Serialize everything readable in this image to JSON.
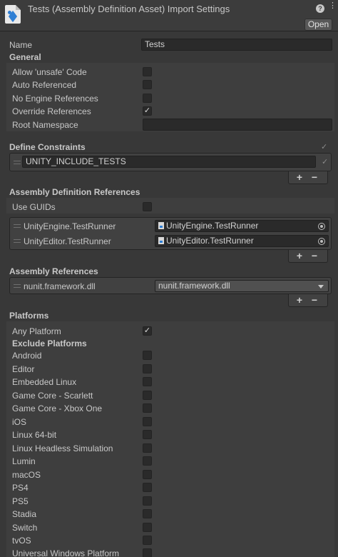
{
  "header": {
    "title": "Tests (Assembly Definition Asset) Import Settings",
    "open_label": "Open",
    "help_glyph": "?",
    "menu_glyph": "⋮",
    "icons": [
      "assembly-definition-icon",
      "help-icon",
      "menu-icon"
    ]
  },
  "name": {
    "label": "Name",
    "value": "Tests"
  },
  "general": {
    "title": "General",
    "items": [
      {
        "label": "Allow 'unsafe' Code",
        "checked": false
      },
      {
        "label": "Auto Referenced",
        "checked": false
      },
      {
        "label": "No Engine References",
        "checked": false
      },
      {
        "label": "Override References",
        "checked": true
      }
    ],
    "root_namespace": {
      "label": "Root Namespace",
      "value": ""
    }
  },
  "define_constraints": {
    "title": "Define Constraints",
    "items": [
      "UNITY_INCLUDE_TESTS"
    ]
  },
  "assembly_definition_references": {
    "title": "Assembly Definition References",
    "use_guids": {
      "label": "Use GUIDs",
      "checked": false
    },
    "items": [
      {
        "label": "UnityEngine.TestRunner",
        "value": "UnityEngine.TestRunner"
      },
      {
        "label": "UnityEditor.TestRunner",
        "value": "UnityEditor.TestRunner"
      }
    ]
  },
  "assembly_references": {
    "title": "Assembly References",
    "items": [
      {
        "label": "nunit.framework.dll",
        "value": "nunit.framework.dll"
      }
    ]
  },
  "platforms": {
    "title": "Platforms",
    "any_platform": {
      "label": "Any Platform",
      "checked": true
    },
    "exclude_title": "Exclude Platforms",
    "items": [
      {
        "label": "Android",
        "checked": false
      },
      {
        "label": "Editor",
        "checked": false
      },
      {
        "label": "Embedded Linux",
        "checked": false
      },
      {
        "label": "Game Core - Scarlett",
        "checked": false
      },
      {
        "label": "Game Core - Xbox One",
        "checked": false
      },
      {
        "label": "iOS",
        "checked": false
      },
      {
        "label": "Linux 64-bit",
        "checked": false
      },
      {
        "label": "Linux Headless Simulation",
        "checked": false
      },
      {
        "label": "Lumin",
        "checked": false
      },
      {
        "label": "macOS",
        "checked": false
      },
      {
        "label": "PS4",
        "checked": false
      },
      {
        "label": "PS5",
        "checked": false
      },
      {
        "label": "Stadia",
        "checked": false
      },
      {
        "label": "Switch",
        "checked": false
      },
      {
        "label": "tvOS",
        "checked": false
      },
      {
        "label": "Universal Windows Platform",
        "checked": false
      }
    ]
  },
  "list_controls": {
    "add_glyph": "+",
    "remove_glyph": "−",
    "check_glyph": "✓"
  }
}
